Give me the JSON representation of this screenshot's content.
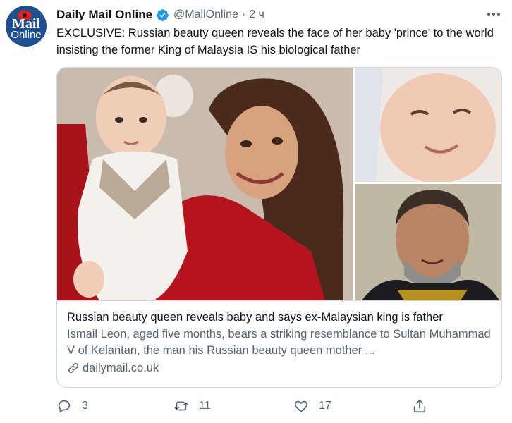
{
  "tweet": {
    "author_name": "Daily Mail Online",
    "handle": "@MailOnline",
    "separator": "·",
    "time": "2 ч",
    "text": "EXCLUSIVE:  Russian beauty queen reveals the face of her baby 'prince' to the world insisting the former King of Malaysia IS his biological father",
    "avatar": {
      "line1": "Mail",
      "line2": "Online"
    }
  },
  "card": {
    "title": "Russian beauty queen reveals baby and says ex-Malaysian king is father",
    "description": "Ismail Leon, aged five months, bears a striking resemblance to Sultan Muhammad V of Kelantan, the man his Russian beauty queen mother ...",
    "domain": "dailymail.co.uk"
  },
  "actions": {
    "reply_count": "3",
    "retweet_count": "11",
    "like_count": "17"
  },
  "icons": {
    "verified": "verified-badge-icon",
    "more": "more-dots-icon",
    "link": "link-icon",
    "reply": "reply-icon",
    "retweet": "retweet-icon",
    "like": "like-icon",
    "share": "share-icon"
  },
  "colors": {
    "verified_blue": "#1d9bf0",
    "secondary_text": "#536471",
    "border": "#cfd9de",
    "avatar_bg": "#1d4f91"
  }
}
